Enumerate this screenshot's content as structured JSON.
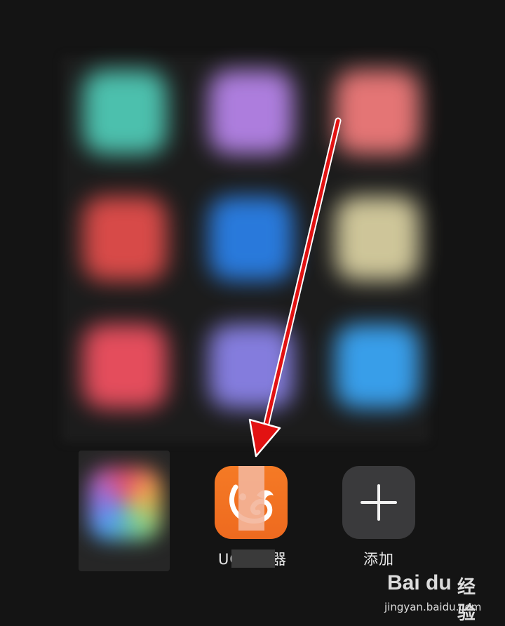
{
  "apps": {
    "uc": {
      "label": "UC浏览器",
      "visible_label_prefix": "UC",
      "visible_label_suffix": "器"
    },
    "add": {
      "label": "添加"
    }
  },
  "blurred_grid_colors": [
    "#4fc9b5",
    "#b583e8",
    "#ef7a7a",
    "#e24d4b",
    "#2a7fe6",
    "#d8cfa0",
    "#ef5060",
    "#8a82e8",
    "#3aa5f5"
  ],
  "watermark": {
    "logo": "Bai du",
    "brand": "经验",
    "url": "jingyan.baidu.com"
  },
  "colors": {
    "arrow": "#e21212",
    "uc_orange": "#f57a25",
    "background": "#141414"
  }
}
